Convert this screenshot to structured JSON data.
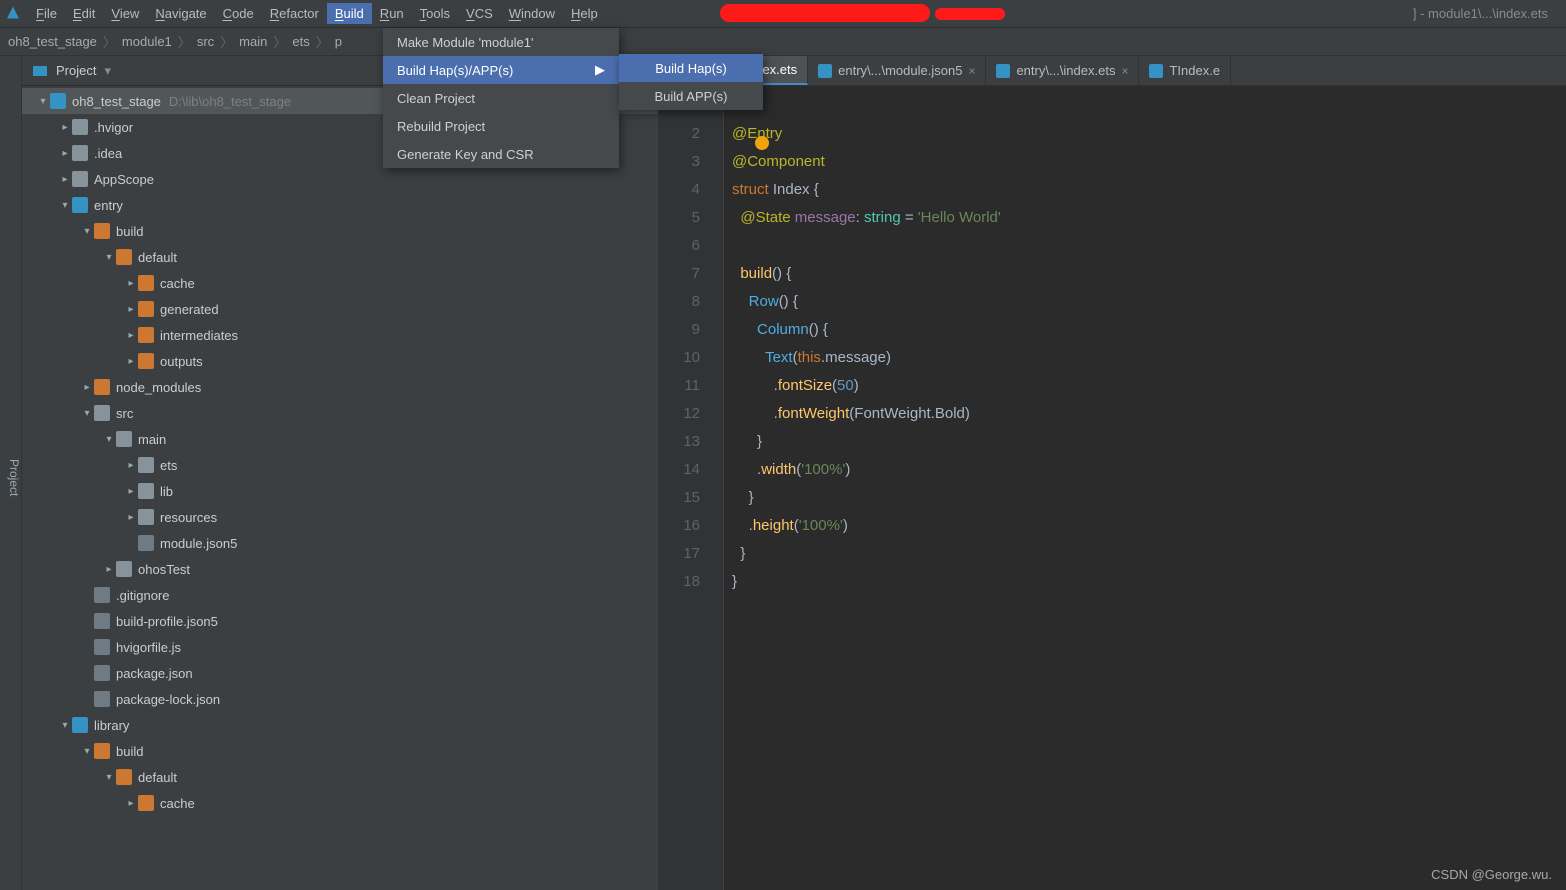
{
  "menubar": {
    "items": [
      "File",
      "Edit",
      "View",
      "Navigate",
      "Code",
      "Refactor",
      "Build",
      "Run",
      "Tools",
      "VCS",
      "Window",
      "Help"
    ],
    "active": "Build",
    "title_suffix": "] - module1\\...\\index.ets"
  },
  "breadcrumbs": [
    "oh8_test_stage",
    "module1",
    "src",
    "main",
    "ets",
    "p"
  ],
  "project_panel": {
    "label": "Project"
  },
  "sidebar_label": "Project",
  "tree": [
    {
      "depth": 0,
      "arrow": "down",
      "icon": "folder-b",
      "name": "oh8_test_stage",
      "path": "D:\\lib\\oh8_test_stage",
      "selected": true
    },
    {
      "depth": 1,
      "arrow": "right",
      "icon": "folder",
      "name": ".hvigor"
    },
    {
      "depth": 1,
      "arrow": "right",
      "icon": "folder",
      "name": ".idea"
    },
    {
      "depth": 1,
      "arrow": "right",
      "icon": "folder",
      "name": "AppScope"
    },
    {
      "depth": 1,
      "arrow": "down",
      "icon": "folder-b",
      "name": "entry"
    },
    {
      "depth": 2,
      "arrow": "down",
      "icon": "folder-o",
      "name": "build"
    },
    {
      "depth": 3,
      "arrow": "down",
      "icon": "folder-o",
      "name": "default"
    },
    {
      "depth": 4,
      "arrow": "right",
      "icon": "folder-o",
      "name": "cache"
    },
    {
      "depth": 4,
      "arrow": "right",
      "icon": "folder-o",
      "name": "generated"
    },
    {
      "depth": 4,
      "arrow": "right",
      "icon": "folder-o",
      "name": "intermediates"
    },
    {
      "depth": 4,
      "arrow": "right",
      "icon": "folder-o",
      "name": "outputs"
    },
    {
      "depth": 2,
      "arrow": "right",
      "icon": "folder-o",
      "name": "node_modules"
    },
    {
      "depth": 2,
      "arrow": "down",
      "icon": "folder",
      "name": "src"
    },
    {
      "depth": 3,
      "arrow": "down",
      "icon": "folder",
      "name": "main"
    },
    {
      "depth": 4,
      "arrow": "right",
      "icon": "folder",
      "name": "ets"
    },
    {
      "depth": 4,
      "arrow": "right",
      "icon": "folder",
      "name": "lib"
    },
    {
      "depth": 4,
      "arrow": "right",
      "icon": "folder",
      "name": "resources"
    },
    {
      "depth": 4,
      "arrow": "none",
      "icon": "file",
      "name": "module.json5"
    },
    {
      "depth": 3,
      "arrow": "right",
      "icon": "folder",
      "name": "ohosTest"
    },
    {
      "depth": 2,
      "arrow": "none",
      "icon": "file",
      "name": ".gitignore"
    },
    {
      "depth": 2,
      "arrow": "none",
      "icon": "file",
      "name": "build-profile.json5"
    },
    {
      "depth": 2,
      "arrow": "none",
      "icon": "file",
      "name": "hvigorfile.js"
    },
    {
      "depth": 2,
      "arrow": "none",
      "icon": "file",
      "name": "package.json"
    },
    {
      "depth": 2,
      "arrow": "none",
      "icon": "file",
      "name": "package-lock.json"
    },
    {
      "depth": 1,
      "arrow": "down",
      "icon": "folder-b",
      "name": "library"
    },
    {
      "depth": 2,
      "arrow": "down",
      "icon": "folder-o",
      "name": "build"
    },
    {
      "depth": 3,
      "arrow": "down",
      "icon": "folder-o",
      "name": "default"
    },
    {
      "depth": 4,
      "arrow": "right",
      "icon": "folder-o",
      "name": "cache"
    }
  ],
  "tabs": [
    {
      "label": "odule1\\...\\index.ets",
      "active": true,
      "truncated": true
    },
    {
      "label": "entry\\...\\module.json5",
      "active": false
    },
    {
      "label": "entry\\...\\index.ets",
      "active": false
    },
    {
      "label": "TIndex.e",
      "active": false,
      "truncated": true
    }
  ],
  "dropdown": {
    "items": [
      "Make Module 'module1'",
      "Build Hap(s)/APP(s)",
      "Clean Project",
      "Rebuild Project",
      "Generate Key and CSR"
    ],
    "highlighted": "Build Hap(s)/APP(s)"
  },
  "submenu": {
    "items": [
      "Build Hap(s)",
      "Build APP(s)"
    ],
    "highlighted": "Build Hap(s)"
  },
  "editor": {
    "line_count": 18,
    "code_tokens": [
      [],
      [
        {
          "t": "@Entry",
          "c": "c-deco"
        }
      ],
      [
        {
          "t": "@Component",
          "c": "c-deco"
        }
      ],
      [
        {
          "t": "struct ",
          "c": "c-kw"
        },
        {
          "t": "Index ",
          "c": "c-struct"
        },
        {
          "t": "{",
          "c": "c-par"
        }
      ],
      [
        {
          "t": "  ",
          "c": ""
        },
        {
          "t": "@State ",
          "c": "c-anno"
        },
        {
          "t": "message",
          "c": "c-prop"
        },
        {
          "t": ": ",
          "c": "c-par"
        },
        {
          "t": "string",
          "c": "c-type"
        },
        {
          "t": " = ",
          "c": "c-par"
        },
        {
          "t": "'Hello World'",
          "c": "c-str"
        }
      ],
      [],
      [
        {
          "t": "  ",
          "c": ""
        },
        {
          "t": "build",
          "c": "c-fn"
        },
        {
          "t": "() {",
          "c": "c-par"
        }
      ],
      [
        {
          "t": "    ",
          "c": ""
        },
        {
          "t": "Row",
          "c": "c-call"
        },
        {
          "t": "() {",
          "c": "c-par"
        }
      ],
      [
        {
          "t": "      ",
          "c": ""
        },
        {
          "t": "Column",
          "c": "c-call"
        },
        {
          "t": "() {",
          "c": "c-par"
        }
      ],
      [
        {
          "t": "        ",
          "c": ""
        },
        {
          "t": "Text",
          "c": "c-call"
        },
        {
          "t": "(",
          "c": "c-par"
        },
        {
          "t": "this",
          "c": "c-kw2"
        },
        {
          "t": ".message)",
          "c": "c-par"
        }
      ],
      [
        {
          "t": "          .",
          "c": "c-par"
        },
        {
          "t": "fontSize",
          "c": "c-fn"
        },
        {
          "t": "(",
          "c": "c-par"
        },
        {
          "t": "50",
          "c": "c-num"
        },
        {
          "t": ")",
          "c": "c-par"
        }
      ],
      [
        {
          "t": "          .",
          "c": "c-par"
        },
        {
          "t": "fontWeight",
          "c": "c-fn"
        },
        {
          "t": "(FontWeight.Bold)",
          "c": "c-par"
        }
      ],
      [
        {
          "t": "      }",
          "c": "c-par"
        }
      ],
      [
        {
          "t": "      .",
          "c": "c-par"
        },
        {
          "t": "width",
          "c": "c-fn"
        },
        {
          "t": "(",
          "c": "c-par"
        },
        {
          "t": "'100%'",
          "c": "c-str"
        },
        {
          "t": ")",
          "c": "c-par"
        }
      ],
      [
        {
          "t": "    }",
          "c": "c-par"
        }
      ],
      [
        {
          "t": "    .",
          "c": "c-par"
        },
        {
          "t": "height",
          "c": "c-fn"
        },
        {
          "t": "(",
          "c": "c-par"
        },
        {
          "t": "'100%'",
          "c": "c-str"
        },
        {
          "t": ")",
          "c": "c-par"
        }
      ],
      [
        {
          "t": "  }",
          "c": "c-par"
        }
      ],
      [
        {
          "t": "}",
          "c": "c-par"
        }
      ]
    ]
  },
  "watermark": "CSDN @George.wu."
}
